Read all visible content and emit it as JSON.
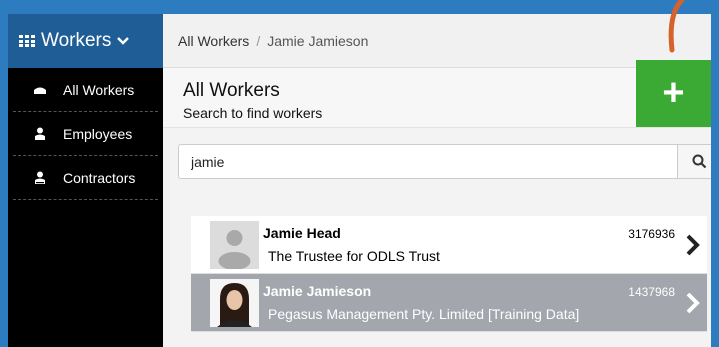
{
  "sidebar": {
    "title": "Workers",
    "items": [
      {
        "label": "All Workers",
        "icon": "briefcase-icon"
      },
      {
        "label": "Employees",
        "icon": "person-icon"
      },
      {
        "label": "Contractors",
        "icon": "contractor-icon"
      }
    ]
  },
  "breadcrumb": {
    "root": "All Workers",
    "separator": "/",
    "current": "Jamie Jamieson"
  },
  "header": {
    "title": "All Workers",
    "subtitle": "Search to find workers",
    "add_label": "+"
  },
  "search": {
    "value": "jamie"
  },
  "results": [
    {
      "name": "Jamie Head",
      "number": "3176936",
      "org": "The Trustee for ODLS Trust",
      "selected": false
    },
    {
      "name": "Jamie Jamieson",
      "number": "1437968",
      "org": "Pegasus Management Pty. Limited [Training Data]",
      "selected": true
    }
  ],
  "colors": {
    "accent": "#3aaa35",
    "header_blue": "#1f5d96",
    "annotation": "#d4622a"
  }
}
